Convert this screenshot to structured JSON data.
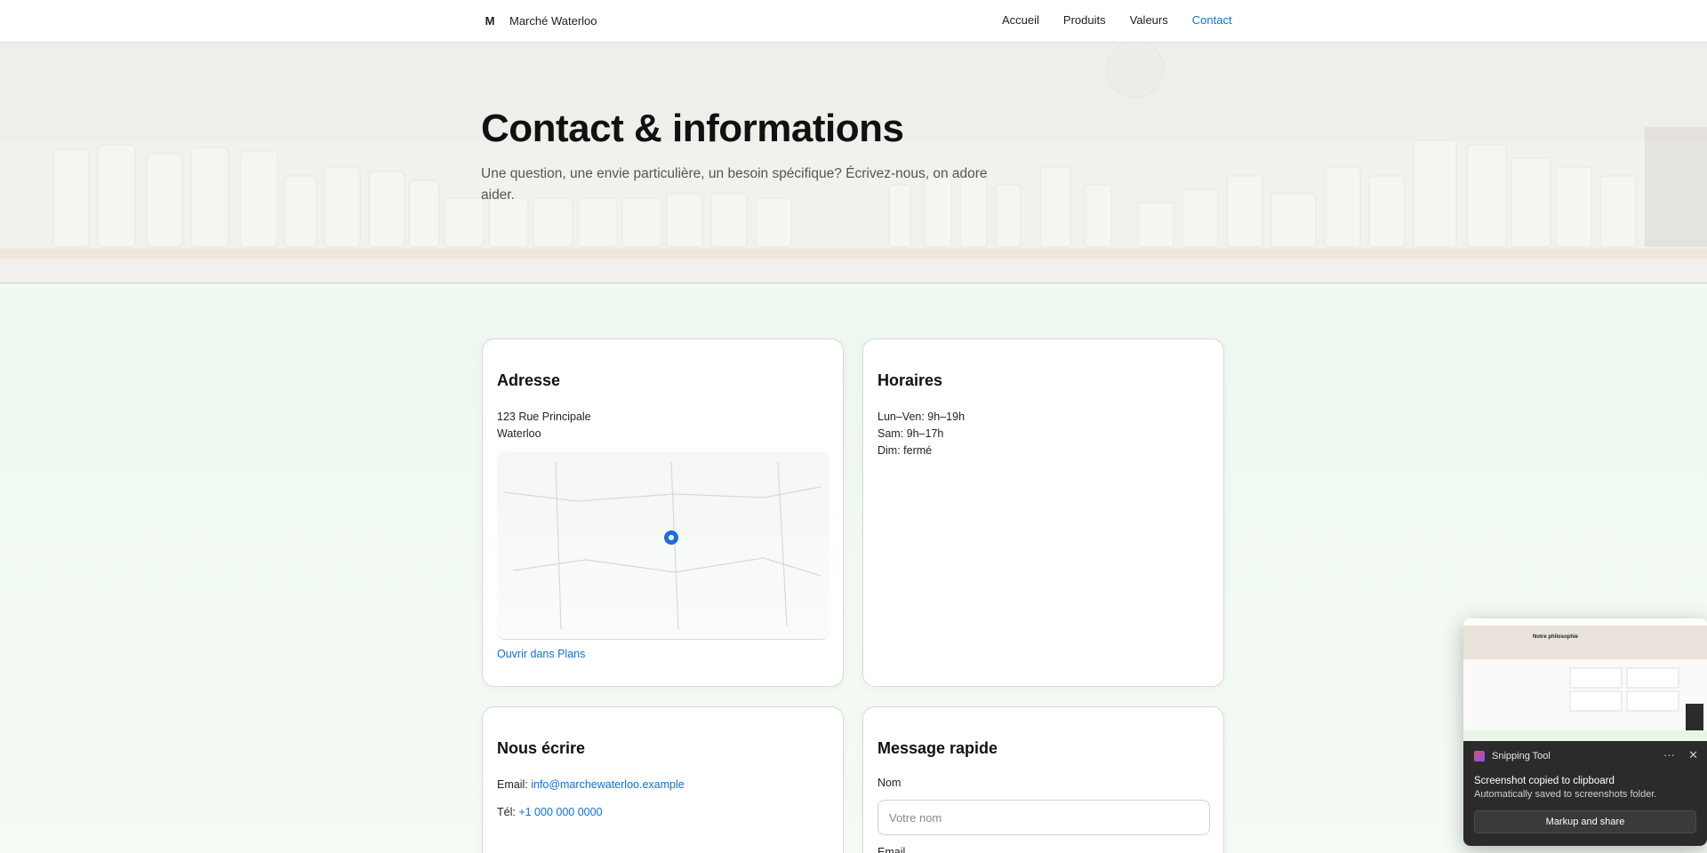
{
  "header": {
    "logo": "M",
    "brand": "Marché Waterloo",
    "nav": [
      {
        "label": "Accueil"
      },
      {
        "label": "Produits"
      },
      {
        "label": "Valeurs"
      },
      {
        "label": "Contact",
        "active": true
      }
    ]
  },
  "hero": {
    "title": "Contact & informations",
    "subtitle": "Une question, une envie particulière, un besoin spécifique? Écrivez-nous, on adore aider."
  },
  "address_card": {
    "title": "Adresse",
    "line1": "123 Rue Principale",
    "line2": "Waterloo",
    "map_icon": "location-pin-icon",
    "map_link": "Ouvrir dans Plans"
  },
  "hours_card": {
    "title": "Horaires",
    "line1": "Lun–Ven: 9h–19h",
    "line2": "Sam: 9h–17h",
    "line3": "Dim: fermé"
  },
  "write_card": {
    "title": "Nous écrire",
    "email_label": "Email:",
    "email_value": "info@marchewaterloo.example",
    "phone_label": "Tél:",
    "phone_value": "+1 000 000 0000"
  },
  "message_card": {
    "title": "Message rapide",
    "name_label": "Nom",
    "name_placeholder": "Votre nom",
    "email_label": "Email"
  },
  "snipping_tool": {
    "app_name": "Snipping Tool",
    "title": "Screenshot copied to clipboard",
    "message": "Automatically saved to screenshots folder.",
    "button": "Markup and share",
    "thumb_heading": "Notre philosophie",
    "more_icon": "more-icon",
    "close_icon": "close-icon"
  },
  "colors": {
    "accent": "#0a72d8",
    "pin": "#1a6fe0",
    "toast": "#2b2b2b"
  }
}
